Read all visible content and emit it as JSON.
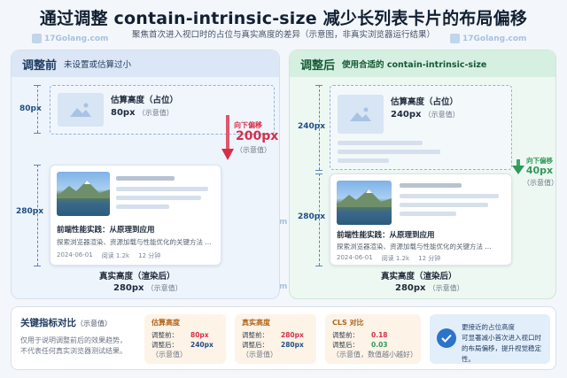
{
  "header": {
    "title": "通过调整 contain-intrinsic-size 减少长列表卡片的布局偏移",
    "subtitle": "聚焦首次进入视口时的占位与真实高度的差异（示意图，非真实浏览器运行结果）"
  },
  "watermark": "17Golang.com",
  "left_panel": {
    "heading": "调整前",
    "subheading": "未设置或估算过小",
    "placeholder_label": "估算高度（占位）",
    "placeholder_value": "80px",
    "placeholder_note": "（示意值）",
    "placeholder_dim": "80px",
    "shift_label": "向下偏移",
    "shift_value": "200px",
    "shift_note": "（示意值）",
    "card_dim": "280px",
    "card": {
      "title": "前端性能实践：从原理到应用",
      "desc": "探索浏览器渲染、资源加载与性能优化的关键方法 ...",
      "date": "2024-06-01",
      "reads": "阅读 1.2k",
      "time": "12 分钟"
    },
    "actual_label": "真实高度（渲染后）",
    "actual_value": "280px",
    "actual_note": "（示意值）"
  },
  "right_panel": {
    "heading": "调整后",
    "subheading": "使用合适的 contain-intrinsic-size",
    "placeholder_label": "估算高度（占位）",
    "placeholder_value": "240px",
    "placeholder_note": "（示意值）",
    "placeholder_dim": "240px",
    "shift_label": "向下偏移",
    "shift_value": "40px",
    "shift_note": "（示意值）",
    "card_dim": "280px",
    "card": {
      "title": "前端性能实践：从原理到应用",
      "desc": "探索浏览器渲染、资源加载与性能优化的关键方法 ...",
      "date": "2024-06-01",
      "reads": "阅读 1.2k",
      "time": "12 分钟"
    },
    "actual_label": "真实高度（渲染后）",
    "actual_value": "280px",
    "actual_note": "（示意值）"
  },
  "metrics": {
    "heading": "关键指标对比",
    "heading_note": "（示意值）",
    "desc1": "仅用于说明调整前后的效果趋势，",
    "desc2": "不代表任何真实浏览器测试结果。",
    "est": {
      "title": "估算高度",
      "before_k": "调整前：",
      "before_v": "80px",
      "after_k": "调整后：",
      "after_v": "240px",
      "note": "（示意值）"
    },
    "real": {
      "title": "真实高度",
      "before_k": "调整前：",
      "before_v": "280px",
      "after_k": "调整后：",
      "after_v": "280px",
      "note": "（示意值）"
    },
    "cls": {
      "title": "CLS 对比",
      "before_k": "调整前：",
      "before_v": "0.18",
      "after_k": "调整后：",
      "after_v": "0.03",
      "note": "（示意值，数值越小越好）"
    },
    "conclusion": [
      "更接近的占位高度",
      "可显著减小首次进入视口时",
      "的布局偏移，提升视觉稳定性。"
    ]
  },
  "colors": {
    "shift_red": "#d62f4a",
    "shift_green": "#2f9a5a",
    "dim_blue": "#1e4f86"
  }
}
